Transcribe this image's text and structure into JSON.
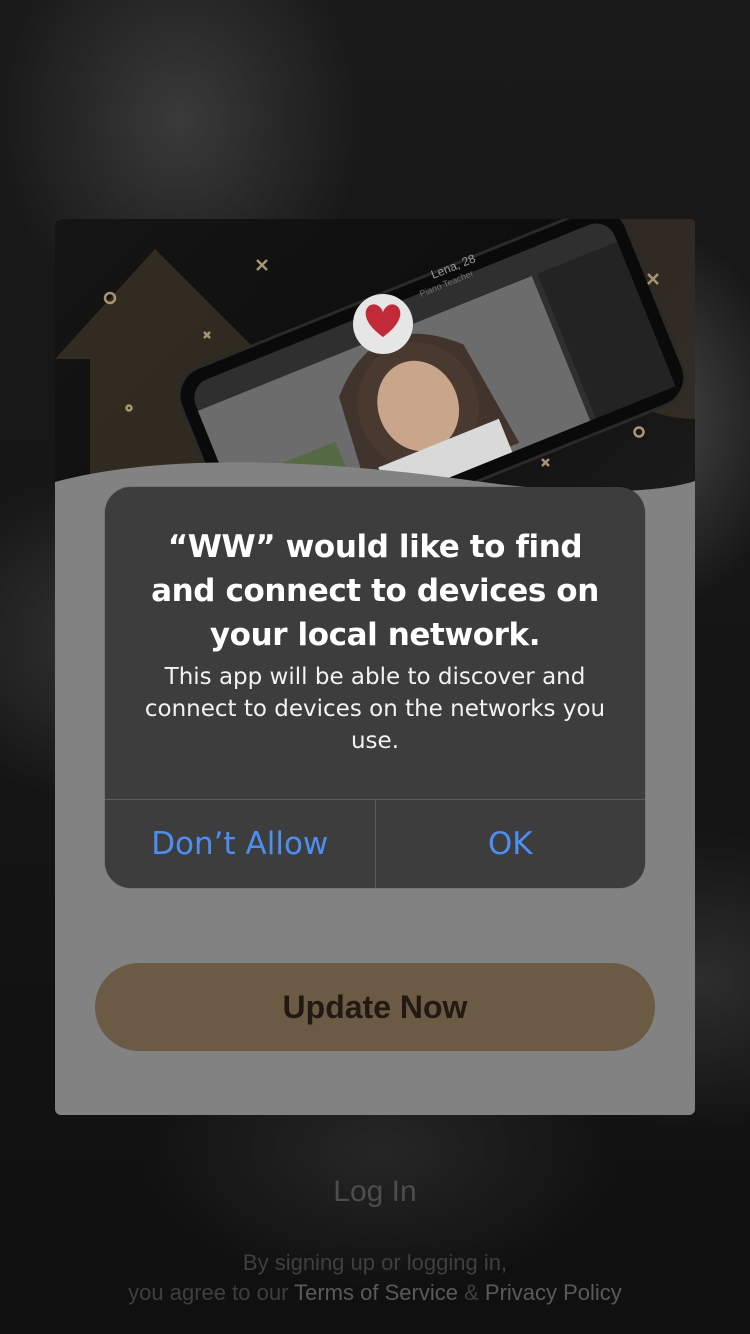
{
  "alert": {
    "title": "“WW” would like to find and connect to devices on your local network.",
    "message": "This app will be able to discover and connect to devices on the networks you use.",
    "deny_label": "Don’t Allow",
    "ok_label": "OK",
    "accent_color": "#4d8ef0"
  },
  "update_card": {
    "update_label": "Update Now",
    "hero_image": "phone-with-dating-profile-photo",
    "hero_profile_text": "Lena, 28",
    "hero_profile_subtext": "Piano Teacher",
    "button_color": "#6b5a44"
  },
  "footer": {
    "login_label": "Log In",
    "legal_line1": "By signing up or logging in,",
    "legal_prefix": "you agree to our",
    "terms_label": "Terms of Service",
    "amp": "&",
    "privacy_label": "Privacy Policy"
  }
}
